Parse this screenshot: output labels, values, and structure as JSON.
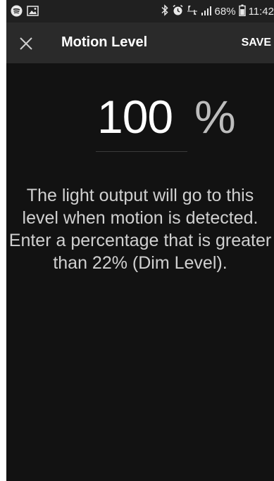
{
  "status_bar": {
    "left_icons": [
      "spotify-icon",
      "image-icon"
    ],
    "right_icons": [
      "bluetooth-icon",
      "alarm-icon",
      "lte-icon",
      "signal-icon",
      "battery-icon"
    ],
    "battery_percent": "68%",
    "time": "11:42"
  },
  "toolbar": {
    "title": "Motion Level",
    "save_label": "SAVE",
    "close_icon": "close-icon"
  },
  "level": {
    "value": "100",
    "unit": "%"
  },
  "message": "The light output will go to this level when motion is detected. Enter a percentage that is greater than 22% (Dim Level).",
  "colors": {
    "background": "#121212",
    "toolbar": "#2a2a2a",
    "status_bar": "#202020",
    "text": "#ffffff"
  }
}
